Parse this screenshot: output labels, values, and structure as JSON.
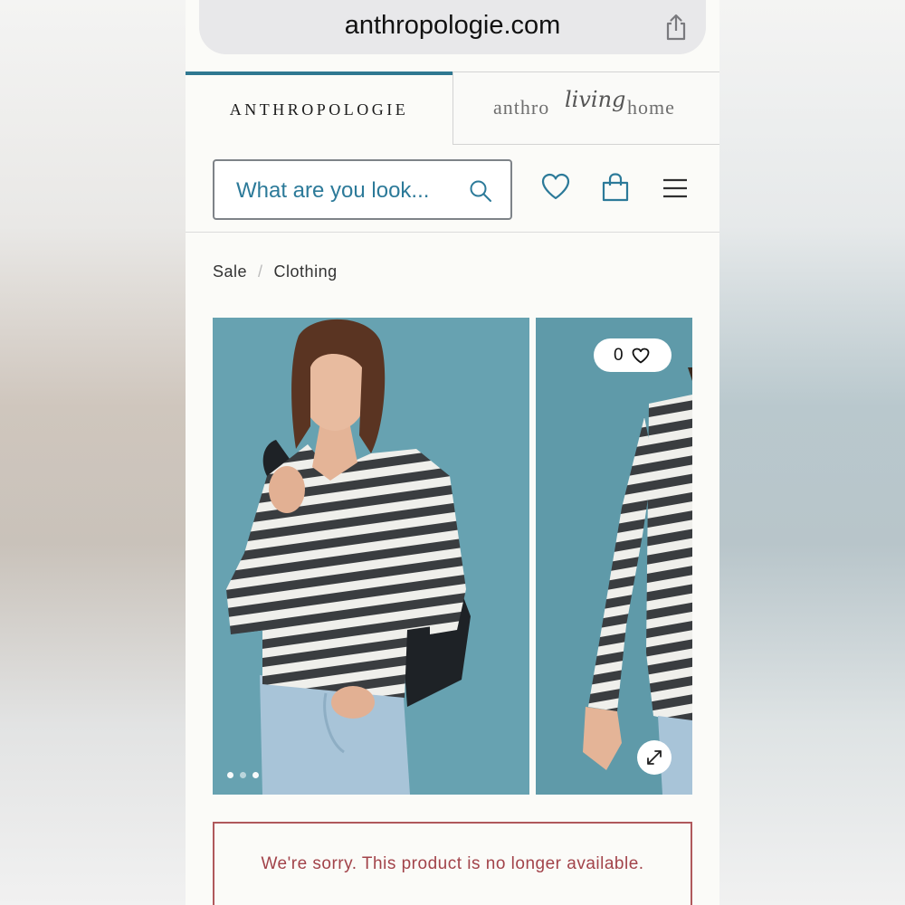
{
  "browser": {
    "url": "anthropologie.com",
    "share_icon": "share-icon"
  },
  "brand_tabs": {
    "anthropologie": "ANTHROPOLOGIE",
    "living_part1": "anthro",
    "living_part2": "living",
    "living_part3": "home"
  },
  "header": {
    "search_placeholder": "What are you look...",
    "icons": [
      "search-icon",
      "heart-icon",
      "bag-icon",
      "menu-icon"
    ]
  },
  "breadcrumb": {
    "items": [
      "Sale",
      "Clothing"
    ],
    "separator": "/"
  },
  "gallery": {
    "favorites_count": "0",
    "slide_count": 3,
    "active_slide": 1,
    "accent_color": "#66a1b0"
  },
  "notice": {
    "message": "We're sorry. This product is no longer available.",
    "color": "#a2434a"
  }
}
